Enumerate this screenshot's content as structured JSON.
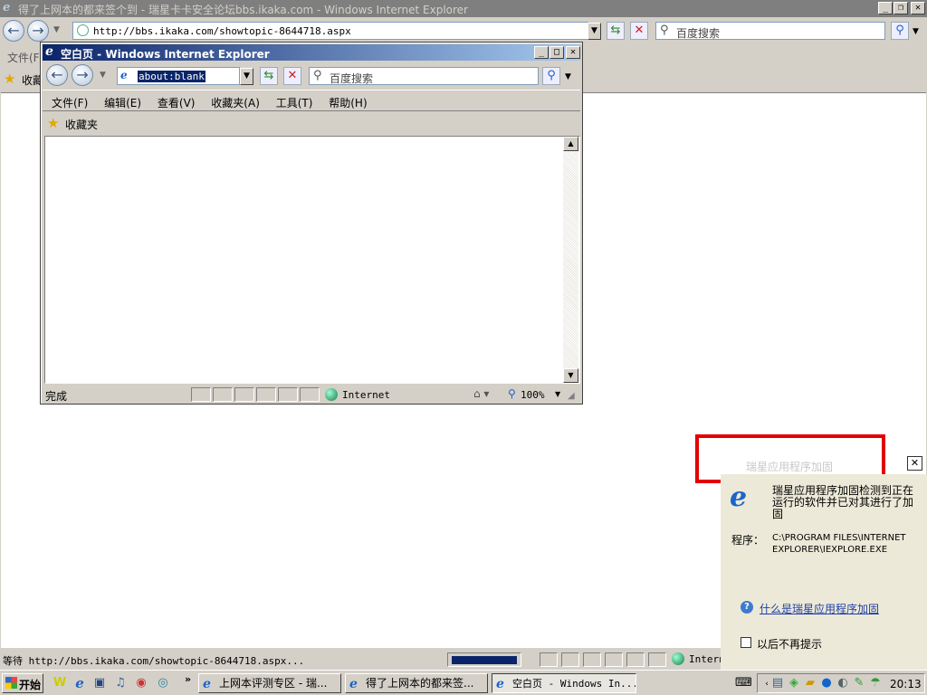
{
  "main_window": {
    "title": "得了上网本的都来签个到 - 瑞星卡卡安全论坛bbs.ikaka.com - Windows Internet Explorer",
    "address": "http://bbs.ikaka.com/showtopic-8644718.aspx",
    "search_placeholder": "百度搜索",
    "menu_partial": "文件(F",
    "fav_partial": "收藏",
    "status_text": "等待 http://bbs.ikaka.com/showtopic-8644718.aspx...",
    "zone_partial": "Intern"
  },
  "popup_window": {
    "title": "空白页 - Windows Internet Explorer",
    "address": "about:blank",
    "search_placeholder": "百度搜索",
    "menu": [
      "文件(F)",
      "编辑(E)",
      "查看(V)",
      "收藏夹(A)",
      "工具(T)",
      "帮助(H)"
    ],
    "favorites": "收藏夹",
    "status_text": "完成",
    "zone": "Internet",
    "zoom": "100%"
  },
  "notification": {
    "header": "瑞星应用程序加固",
    "message": "瑞星应用程序加固检测到正在运行的软件并已对其进行了加固",
    "program_label": "程序：",
    "program_path": "C:\\PROGRAM FILES\\INTERNET EXPLORER\\IEXPLORE.EXE",
    "link": "什么是瑞星应用程序加固",
    "checkbox_label": "以后不再提示",
    "highlight_color": "#e30000"
  },
  "taskbar": {
    "start": "开始",
    "tasks": [
      {
        "label": "上网本评测专区 - 瑞..."
      },
      {
        "label": "得了上网本的都来签..."
      },
      {
        "label": "空白页 - Windows In..."
      }
    ],
    "clock": "20:13"
  }
}
